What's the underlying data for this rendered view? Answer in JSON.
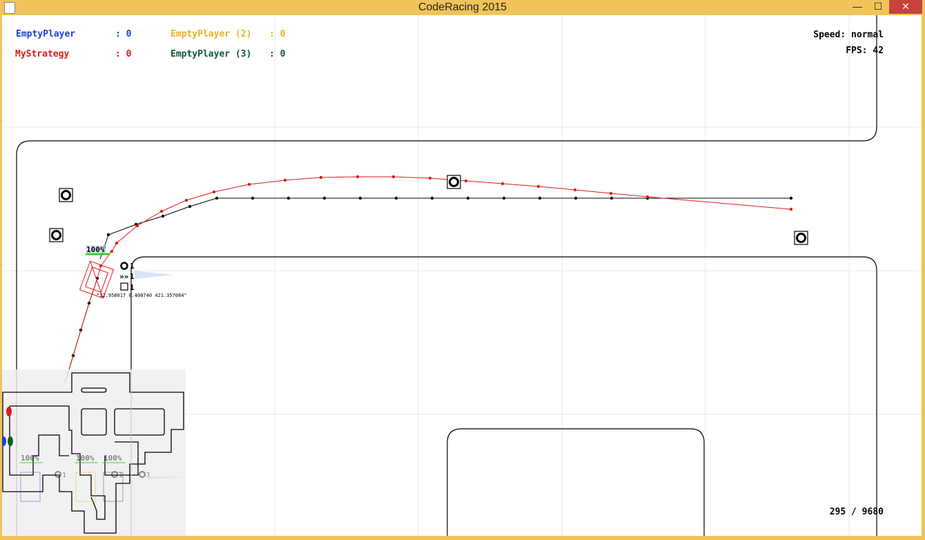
{
  "window": {
    "title": "CodeRacing 2015",
    "minimize": "—",
    "maximize": "☐",
    "close": "✕"
  },
  "scoreboard": [
    {
      "name": "EmptyPlayer",
      "score": ": 0",
      "color": "#1f3fd0"
    },
    {
      "name": "MyStrategy",
      "score": ": 0",
      "color": "#e01a1a"
    },
    {
      "name": "EmptyPlayer (2)",
      "score": ": 0",
      "color": "#f0b020"
    },
    {
      "name": "EmptyPlayer (3)",
      "score": ": 0",
      "color": "#0d5a2c"
    }
  ],
  "speed": "Speed: normal",
  "fps": "FPS: 42",
  "tick_counter": "295 / 9680",
  "car": {
    "durability": "100%",
    "debug_text": "\"12.958017 0.400740 421.357084\"",
    "nitro_count": "1",
    "oil_count": "1",
    "projectile_count": "1"
  },
  "minimap": {
    "car_labels": [
      "100%",
      "100%",
      "100%"
    ],
    "counts": [
      "1",
      "1",
      "1"
    ]
  },
  "colors": {
    "window_frame": "#f0c45a",
    "route_red": "#e01a1a",
    "route_black": "#000000"
  }
}
